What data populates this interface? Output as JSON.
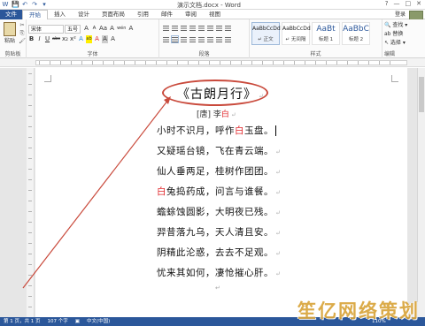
{
  "window": {
    "title": "演示文档.docx - Word",
    "controls": [
      "?",
      "—",
      "□",
      "✕"
    ],
    "user": "登录"
  },
  "quick_access": [
    "W",
    "💾",
    "↶",
    "↷",
    "▾"
  ],
  "tabs": [
    {
      "label": "文件",
      "active": false,
      "is_file": true
    },
    {
      "label": "开始",
      "active": true
    },
    {
      "label": "插入",
      "active": false
    },
    {
      "label": "设计",
      "active": false
    },
    {
      "label": "页面布局",
      "active": false
    },
    {
      "label": "引用",
      "active": false
    },
    {
      "label": "邮件",
      "active": false
    },
    {
      "label": "审阅",
      "active": false
    },
    {
      "label": "视图",
      "active": false
    }
  ],
  "ribbon": {
    "clipboard": {
      "paste_label": "粘贴",
      "group_label": "剪贴板"
    },
    "font": {
      "name": "宋体",
      "size": "五号",
      "group_label": "字体",
      "row1": [
        "A",
        "A",
        "Aa",
        "A",
        "wén",
        "A"
      ],
      "row2": [
        "B",
        "I",
        "U",
        "abc",
        "x₂",
        "x²",
        "A",
        "ab",
        "A",
        "A",
        "A"
      ]
    },
    "paragraph": {
      "group_label": "段落"
    },
    "styles": {
      "group_label": "样式",
      "items": [
        {
          "preview": "AaBbCcDd",
          "name": "↵ 正文",
          "selected": true
        },
        {
          "preview": "AaBbCcDd",
          "name": "↵ 无间隔",
          "selected": false
        },
        {
          "preview": "AaBt",
          "name": "标题 1",
          "selected": false,
          "big": true
        },
        {
          "preview": "AaBbC",
          "name": "标题 2",
          "selected": false,
          "big": true
        }
      ]
    },
    "editing": {
      "items": [
        "🔍 查找 ▾",
        "ab 替换",
        "↖ 选择 ▾"
      ],
      "group_label": "编辑"
    }
  },
  "document": {
    "title": "《古朗月行》",
    "author_prefix": "[唐] 李",
    "author_red": "白",
    "lines": [
      {
        "parts": [
          {
            "t": "小时不识月，呼作"
          },
          {
            "t": "白",
            "red": true
          },
          {
            "t": "玉盘。"
          }
        ],
        "cursor": true
      },
      {
        "parts": [
          {
            "t": "又疑瑶台镜，飞在青云端。"
          }
        ]
      },
      {
        "parts": [
          {
            "t": "仙人垂两足，桂树作团团。"
          }
        ]
      },
      {
        "parts": [
          {
            "t": "白",
            "red": true
          },
          {
            "t": "兔捣药成，问言与谁餐。"
          }
        ]
      },
      {
        "parts": [
          {
            "t": "蟾蜍蚀圆影，大明夜已残。"
          }
        ]
      },
      {
        "parts": [
          {
            "t": "羿昔落九乌，天人清且安。"
          }
        ]
      },
      {
        "parts": [
          {
            "t": "阴精此沦惑，去去不足观。"
          }
        ]
      },
      {
        "parts": [
          {
            "t": "忧来其如何，凄怆摧心肝。"
          }
        ]
      }
    ],
    "paragraph_mark": "↵"
  },
  "annotation": {
    "color": "#c94a3c"
  },
  "statusbar": {
    "page": "第 1 页，共 1 页",
    "words": "107 个字",
    "language": "中文(中国)",
    "zoom": "110%"
  },
  "watermark": "笙亿网络策划",
  "colors": {
    "accent": "#2b579a",
    "red_text": "#e0262a"
  }
}
